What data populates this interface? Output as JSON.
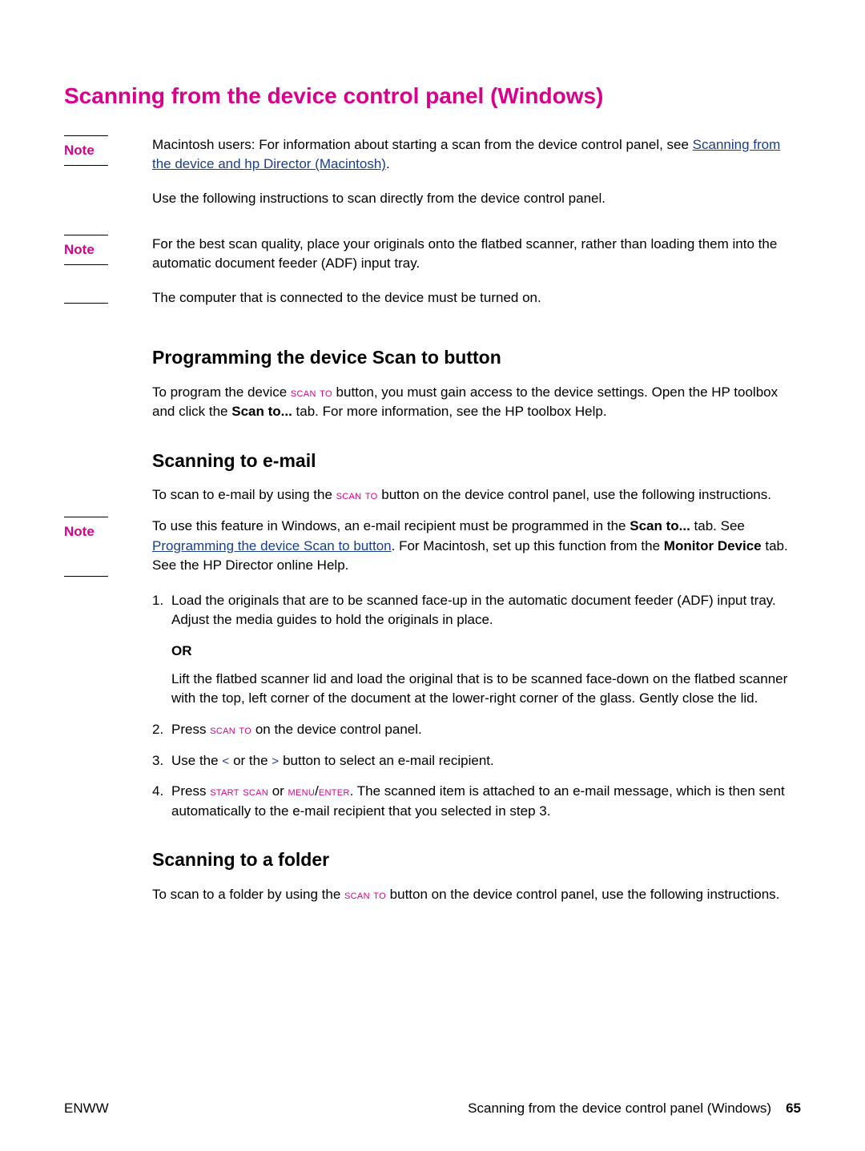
{
  "title": "Scanning from the device control panel (Windows)",
  "notes": [
    {
      "label": "Note",
      "text_before": "Macintosh users: For information about starting a scan from the device control panel, see ",
      "link": "Scanning from the device and hp Director (Macintosh)",
      "text_after": "."
    }
  ],
  "intro_para": "Use the following instructions to scan directly from the device control panel.",
  "note2": {
    "label": "Note",
    "text": "For the best scan quality, place your originals onto the flatbed scanner, rather than loading them into the automatic document feeder (ADF) input tray."
  },
  "after_note2": "The computer that is connected to the device must be turned on.",
  "section1": {
    "heading": "Programming the device Scan to button",
    "p1_a": "To program the device ",
    "p1_btn": "scan to",
    "p1_b": " button, you must gain access to the device settings. Open the HP toolbox and click the ",
    "p1_bold": "Scan to...",
    "p1_c": " tab. For more information, see the HP toolbox Help."
  },
  "section2": {
    "heading": "Scanning to e-mail",
    "p1_a": "To scan to e-mail by using the ",
    "p1_btn": "scan to",
    "p1_b": " button on the device control panel, use the following instructions."
  },
  "note3": {
    "label": "Note",
    "a": "To use this feature in Windows, an e-mail recipient must be programmed in the ",
    "bold1": "Scan to...",
    "b": " tab. See ",
    "link": "Programming the device Scan to button",
    "c": ". For Macintosh, set up this function from the ",
    "bold2": "Monitor Device",
    "d": " tab. See the HP Director online Help."
  },
  "steps": {
    "s1a": "Load the originals that are to be scanned face-up in the automatic document feeder (ADF) input tray. Adjust the media guides to hold the originals in place.",
    "or": "OR",
    "s1b": "Lift the flatbed scanner lid and load the original that is to be scanned face-down on the flatbed scanner with the top, left corner of the document at the lower-right corner of the glass. Gently close the lid.",
    "s2a": "Press ",
    "s2btn": "scan to",
    "s2b": " on the device control panel.",
    "s3a": "Use the ",
    "s3lt": "<",
    "s3mid": " or the ",
    "s3gt": ">",
    "s3b": " button to select an e-mail recipient.",
    "s4a": "Press ",
    "s4btn1": "start scan",
    "s4mid": " or ",
    "s4btn2": "menu",
    "s4slash": "/",
    "s4btn3": "enter",
    "s4b": ". The scanned item is attached to an e-mail message, which is then sent automatically to the e-mail recipient that you selected in step 3."
  },
  "section3": {
    "heading": "Scanning to a folder",
    "p1_a": "To scan to a folder by using the ",
    "p1_btn": "scan to",
    "p1_b": " button on the device control panel, use the following instructions."
  },
  "footer": {
    "left": "ENWW",
    "right": "Scanning from the device control panel (Windows)",
    "page": "65"
  }
}
